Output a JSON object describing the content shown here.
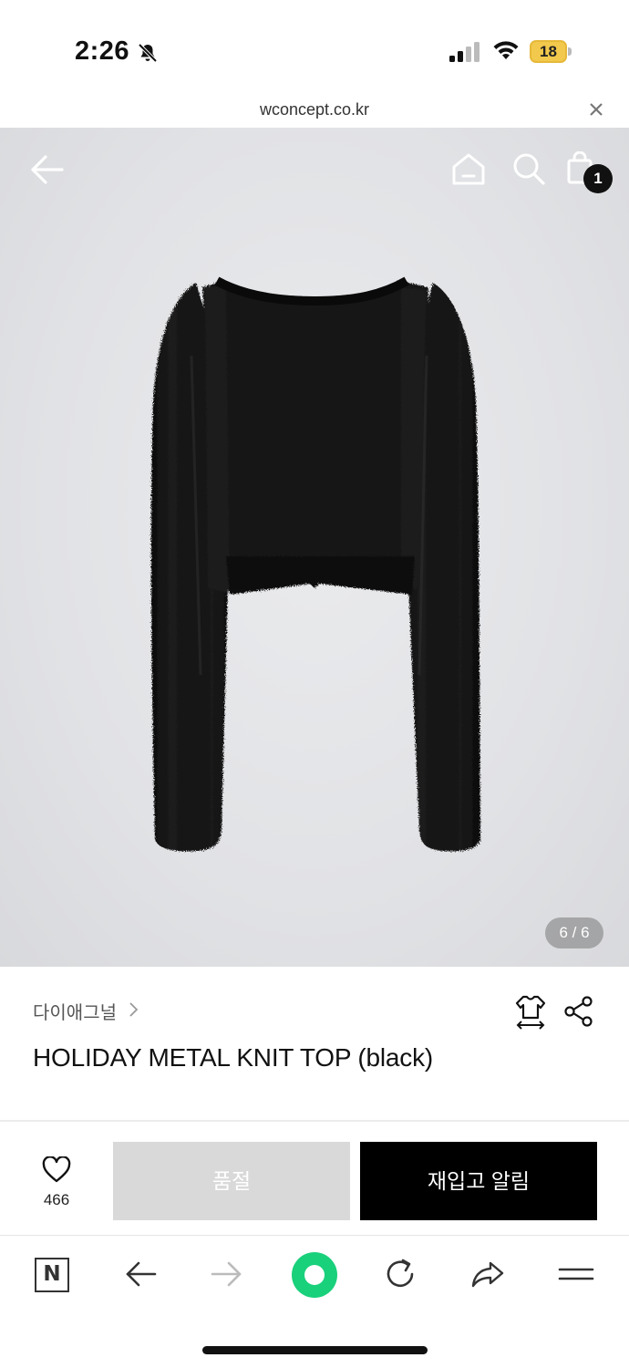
{
  "status_bar": {
    "time": "2:26",
    "battery": "18",
    "icons": [
      "bell-slash-icon",
      "signal-icon",
      "wifi-icon",
      "battery-icon"
    ]
  },
  "url_bar": {
    "url": "wconcept.co.kr",
    "close_icon": "close-icon"
  },
  "header": {
    "icons": [
      "back-arrow-icon",
      "home-icon",
      "search-icon",
      "shopping-bag-icon"
    ],
    "cart_count": "1"
  },
  "gallery": {
    "page_indicator": "6 / 6",
    "image": "black cropped knit sweater"
  },
  "product": {
    "brand": "다이애그널",
    "brand_chevron": "chevron-right-icon",
    "title": "HOLIDAY METAL KNIT TOP (black)",
    "icons": [
      "size-guide-icon",
      "share-icon"
    ]
  },
  "actions": {
    "wish_count": "466",
    "soldout_label": "품절",
    "restock_label": "재입고 알림"
  },
  "browser_toolbar": {
    "n_label": "N",
    "icons": [
      "naver-n-icon",
      "back-icon",
      "forward-icon",
      "green-dot-icon",
      "reload-icon",
      "share-arrow-icon",
      "menu-icon"
    ]
  },
  "colors": {
    "accent_green": "#19d07b",
    "battery_yellow": "#f2c94c",
    "soldout_gray": "#d9d9d9",
    "primary_black": "#000000"
  }
}
